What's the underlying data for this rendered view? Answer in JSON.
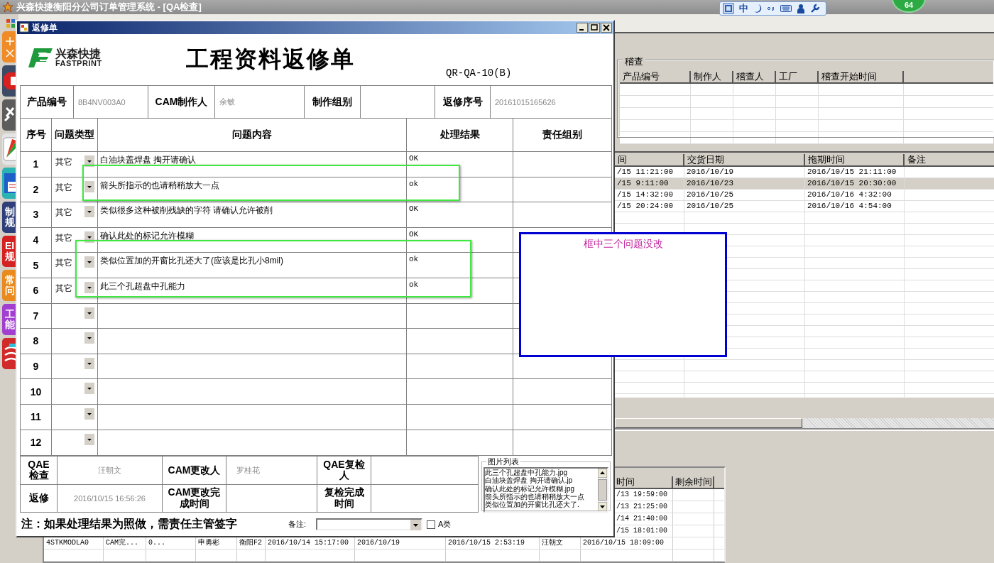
{
  "app": {
    "title": "兴森快捷衡阳分公司订单管理系统 - [QA检查]"
  },
  "left_tiles": [
    {
      "kind": "add-remove",
      "color": "#f08c28"
    },
    {
      "kind": "stop",
      "color": "#3c4a66"
    },
    {
      "kind": "tools",
      "color": "#5c5c5c"
    },
    {
      "kind": "chart",
      "color": "#e4e4e4"
    },
    {
      "kind": "document",
      "color": "#2bb3b3"
    },
    {
      "kind": "text",
      "label": "制规",
      "color": "#2e3f7a"
    },
    {
      "kind": "text",
      "label": "EI规",
      "color": "#d42222"
    },
    {
      "kind": "text",
      "label": "常问",
      "color": "#e88a1e"
    },
    {
      "kind": "text",
      "label": "工能",
      "color": "#a23fd0"
    },
    {
      "kind": "stack",
      "color": "#d02a2a"
    }
  ],
  "ime_toolbar": {
    "mode": "中"
  },
  "badge": {
    "text": "64"
  },
  "audit": {
    "title": "稽查",
    "columns": [
      "产品编号",
      "制作人",
      "稽查人",
      "工厂",
      "稽查开始时间"
    ]
  },
  "orders": {
    "columns": [
      "间",
      "交货日期",
      "拖期时间",
      "备注"
    ],
    "rows": [
      {
        "cells": [
          "/15 11:21:00",
          "2016/10/19",
          "2016/10/15 21:11:00"
        ],
        "selected": false
      },
      {
        "cells": [
          "/15 9:11:00",
          "2016/10/23",
          "2016/10/15 20:30:00"
        ],
        "selected": true
      },
      {
        "cells": [
          "/15 14:32:00",
          "2016/10/25",
          "2016/10/16 4:32:00"
        ],
        "selected": false
      },
      {
        "cells": [
          "/15 20:24:00",
          "2016/10/25",
          "2016/10/16 4:54:00"
        ],
        "selected": false
      }
    ]
  },
  "lower_table": {
    "columns": [
      "时间",
      "剩余时间"
    ],
    "rows": [
      {
        "cells": [
          "/13 19:59:00"
        ]
      },
      {
        "cells": [
          "/13 21:25:00"
        ]
      },
      {
        "cells": [
          "/14 21:40:00"
        ]
      },
      {
        "cells": [
          "/15 18:01:00"
        ]
      },
      {
        "cells": [
          "4STKMODLA0",
          "CAM完...",
          "0...",
          "申勇彬",
          "衡阳F2",
          "2016/10/14 15:17:00",
          "2016/10/19",
          "2016/10/15 2:53:19",
          "汪朝文",
          "2016/10/15 18:09:00"
        ]
      }
    ]
  },
  "dialog": {
    "title": "返修单",
    "logo": {
      "name": "兴森快捷",
      "sub": "FASTPRINT"
    },
    "heading": "工程资料返修单",
    "form_code": "QR-QA-10(B)",
    "info": [
      {
        "label": "产品编号",
        "value": "8B4NV003A0"
      },
      {
        "label": "CAM制作人",
        "value": "余敏"
      },
      {
        "label": "制作组别"
      },
      {
        "label": "返修序号",
        "value": "20161015165626"
      }
    ],
    "issues": {
      "columns": [
        "序号",
        "问题类型",
        "问题内容",
        "处理结果",
        "责任组别"
      ],
      "rows": [
        {
          "no": "1",
          "type": "其它",
          "content": "白油块盖焊盘  掏开请确认",
          "result": "OK"
        },
        {
          "no": "2",
          "type": "其它",
          "content": "箭头所指示的也请稍稍放大一点",
          "result": "ok"
        },
        {
          "no": "3",
          "type": "其它",
          "content": "类似很多这种被削残缺的字符  请确认允许被削",
          "result": "OK"
        },
        {
          "no": "4",
          "type": "其它",
          "content": "确认此处的标记允许模糊",
          "result": "OK"
        },
        {
          "no": "5",
          "type": "其它",
          "content": "类似位置加的开窗比孔还大了(应该是比孔小8mil)",
          "result": "ok"
        },
        {
          "no": "6",
          "type": "其它",
          "content": "此三个孔超盘中孔能力",
          "result": "ok"
        },
        {
          "no": "7"
        },
        {
          "no": "8"
        },
        {
          "no": "9"
        },
        {
          "no": "10"
        },
        {
          "no": "11"
        },
        {
          "no": "12"
        }
      ]
    },
    "signoff": [
      [
        {
          "label": "QAE检查",
          "value": "汪朝文"
        },
        {
          "label": "CAM更改人",
          "value": "罗桂花"
        },
        {
          "label": "QAE复检人"
        }
      ],
      [
        {
          "label": "返修",
          "value": "2016/10/15 16:56:26"
        },
        {
          "label": "CAM更改完成时间"
        },
        {
          "label": "复检完成时间"
        }
      ]
    ],
    "images": {
      "title": "图片列表",
      "items": [
        "此三个孔超盘中孔能力.jpg",
        "白油块盖焊盘  掏开请确认.jp",
        "确认此处的标记允许模糊.jpg",
        "箭头所指示的也请稍稍放大一点",
        "类似位置加的开窗比孔还大了."
      ]
    },
    "note": "注：如果处理结果为照做，需责任主管签字",
    "remark": {
      "label": "备注:"
    },
    "class_a": {
      "label": "A类",
      "checked": false
    }
  },
  "annotation": {
    "text": "框中三个问题没改"
  }
}
